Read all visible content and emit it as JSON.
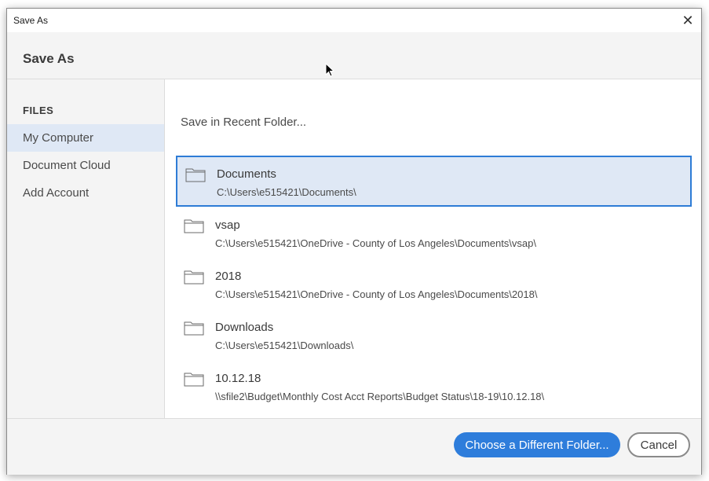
{
  "window": {
    "title": "Save As",
    "close_glyph": "✕"
  },
  "header": {
    "heading": "Save As"
  },
  "sidebar": {
    "section_label": "FILES",
    "items": [
      {
        "label": "My Computer",
        "active": true
      },
      {
        "label": "Document Cloud",
        "active": false
      },
      {
        "label": "Add Account",
        "active": false
      }
    ]
  },
  "main": {
    "recent_label": "Save in Recent Folder...",
    "folders": [
      {
        "name": "Documents",
        "path": "C:\\Users\\e515421\\Documents\\",
        "selected": true,
        "icon": "folder-icon"
      },
      {
        "name": "vsap",
        "path": "C:\\Users\\e515421\\OneDrive - County of Los Angeles\\Documents\\vsap\\",
        "selected": false,
        "icon": "folder-icon"
      },
      {
        "name": "2018",
        "path": "C:\\Users\\e515421\\OneDrive - County of Los Angeles\\Documents\\2018\\",
        "selected": false,
        "icon": "folder-icon"
      },
      {
        "name": "Downloads",
        "path": "C:\\Users\\e515421\\Downloads\\",
        "selected": false,
        "icon": "folder-icon"
      },
      {
        "name": "10.12.18",
        "path": "\\\\sfile2\\Budget\\Monthly Cost Acct Reports\\Budget Status\\18-19\\10.12.18\\",
        "selected": false,
        "icon": "folder-icon"
      }
    ]
  },
  "footer": {
    "choose_folder_label": "Choose a Different Folder...",
    "cancel_label": "Cancel"
  },
  "colors": {
    "accent": "#2e7ddb",
    "selected_bg": "#dfe8f5",
    "panel_bg": "#f4f4f4"
  }
}
